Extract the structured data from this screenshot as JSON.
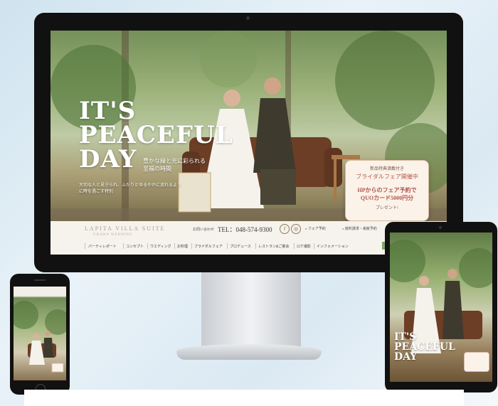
{
  "hero": {
    "title_lines": [
      "IT'S",
      "PEACEFUL",
      "DAY"
    ],
    "subtitle": "豊かな緑と光に彩られる至福の時間",
    "body": "大切な人と見守られ、ふたりとゆるやかに流れるように時を過ごす特別"
  },
  "fair_badge": {
    "line1": "新品特典満載付き",
    "line2": "ブライダルフェア開催中",
    "line3": "HPからのフェア予約で",
    "line4": "QUOカード5000円分",
    "line5": "プレゼント!"
  },
  "header": {
    "logo": "LAPITA VILLA SUITE",
    "logo_sub": "URAWA WEDDING",
    "tel_label": "お問い合わせ",
    "tel": "TEL：048-574-9300",
    "social": [
      {
        "icon": "facebook-icon",
        "glyph": "f"
      },
      {
        "icon": "instagram-icon",
        "glyph": "◎"
      }
    ],
    "fair_link": "» フェア予約",
    "request_link": "» 資料請求・来館予約"
  },
  "nav": {
    "items": [
      "パーティレポート",
      "コンセプト",
      "ウエディング",
      "お料理",
      "ブライダルフェア",
      "プロデュース",
      "レストラン&ご宴会",
      "ロケ撮影",
      "インフォメーション"
    ],
    "cta": "ご予約 / ネットで"
  },
  "tablet": {
    "title_lines": [
      "IT'S",
      "PEACEFUL",
      "DAY"
    ]
  }
}
